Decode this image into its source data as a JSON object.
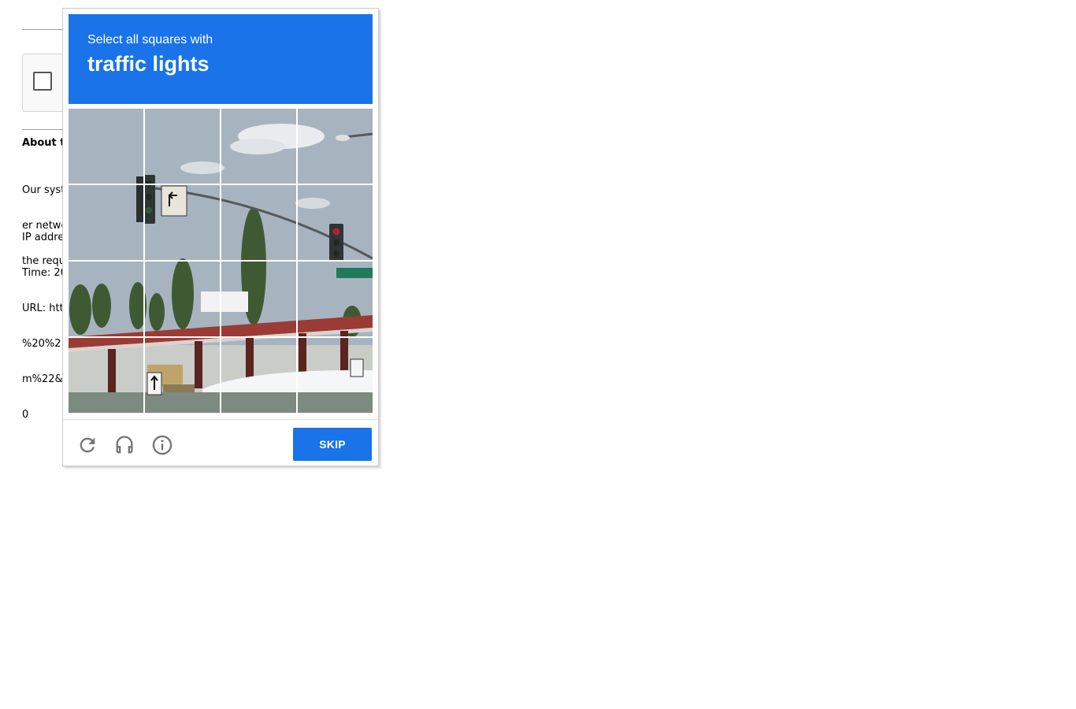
{
  "background_page": {
    "heading_fragment": "About t",
    "paragraph_lines": [
      "Our syst",
      "er netwo",
      "the requ"
    ],
    "details_lines": [
      "IP addre",
      "Time: 20",
      "URL: htt",
      "%20%2",
      "m%22&",
      "0"
    ]
  },
  "challenge": {
    "instruction": "Select all squares with",
    "target": "traffic lights",
    "grid": {
      "rows": 4,
      "cols": 4
    },
    "footer": {
      "reload_icon": "reload-icon",
      "audio_icon": "headphones-icon",
      "info_icon": "info-icon",
      "skip_label": "SKIP"
    },
    "colors": {
      "accent": "#1a73e8",
      "sky": "#a7b4c0",
      "pole": "#55595c",
      "canopy_red": "#9b3b35",
      "trees": "#3f5a32"
    }
  }
}
